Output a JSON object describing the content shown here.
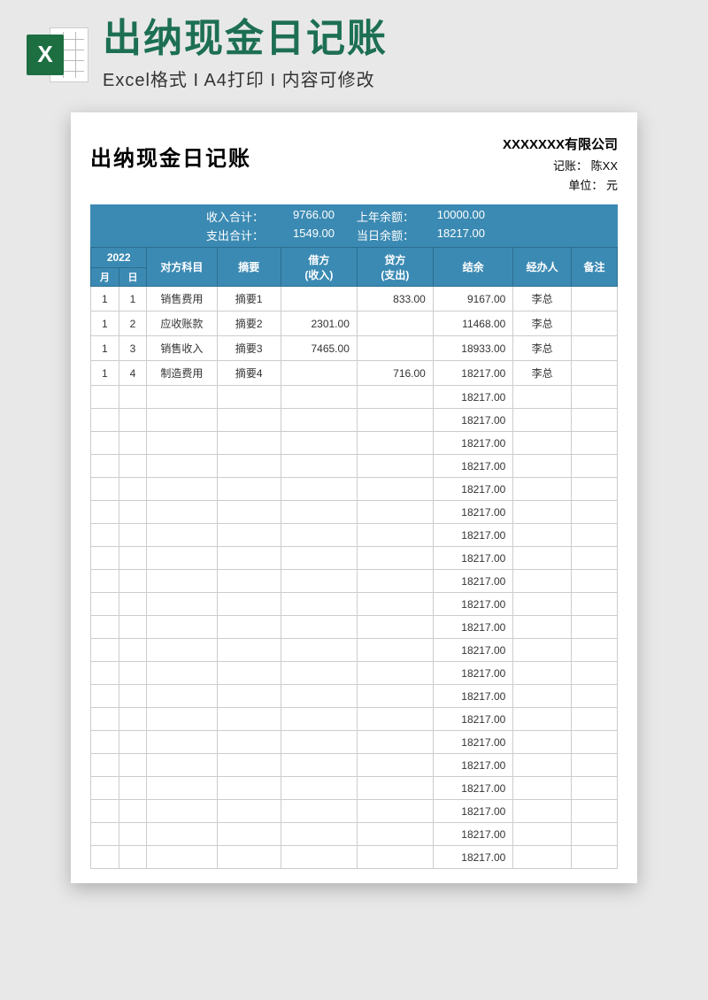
{
  "banner": {
    "excel_letter": "X",
    "title": "出纳现金日记账",
    "subtitle": "Excel格式 I A4打印 I 内容可修改"
  },
  "doc": {
    "title": "出纳现金日记账",
    "company": "XXXXXXX有限公司",
    "recorder_label": "记账：",
    "recorder": "陈XX",
    "unit_label": "单位：",
    "unit": "元"
  },
  "summary": {
    "income_label": "收入合计：",
    "income_value": "9766.00",
    "expense_label": "支出合计：",
    "expense_value": "1549.00",
    "prev_balance_label": "上年余额：",
    "prev_balance_value": "10000.00",
    "today_balance_label": "当日余额：",
    "today_balance_value": "18217.00"
  },
  "headers": {
    "year": "2022",
    "month": "月",
    "day": "日",
    "subject": "对方科目",
    "summary": "摘要",
    "debit": "借方",
    "debit_sub": "(收入)",
    "credit": "贷方",
    "credit_sub": "(支出)",
    "balance": "结余",
    "operator": "经办人",
    "remark": "备注"
  },
  "rows": [
    {
      "m": "1",
      "d": "1",
      "subject": "销售费用",
      "summary": "摘要1",
      "debit": "",
      "credit": "833.00",
      "balance": "9167.00",
      "op": "李总",
      "rm": ""
    },
    {
      "m": "1",
      "d": "2",
      "subject": "应收账款",
      "summary": "摘要2",
      "debit": "2301.00",
      "credit": "",
      "balance": "11468.00",
      "op": "李总",
      "rm": ""
    },
    {
      "m": "1",
      "d": "3",
      "subject": "销售收入",
      "summary": "摘要3",
      "debit": "7465.00",
      "credit": "",
      "balance": "18933.00",
      "op": "李总",
      "rm": ""
    },
    {
      "m": "1",
      "d": "4",
      "subject": "制造费用",
      "summary": "摘要4",
      "debit": "",
      "credit": "716.00",
      "balance": "18217.00",
      "op": "李总",
      "rm": ""
    },
    {
      "m": "",
      "d": "",
      "subject": "",
      "summary": "",
      "debit": "",
      "credit": "",
      "balance": "18217.00",
      "op": "",
      "rm": ""
    },
    {
      "m": "",
      "d": "",
      "subject": "",
      "summary": "",
      "debit": "",
      "credit": "",
      "balance": "18217.00",
      "op": "",
      "rm": ""
    },
    {
      "m": "",
      "d": "",
      "subject": "",
      "summary": "",
      "debit": "",
      "credit": "",
      "balance": "18217.00",
      "op": "",
      "rm": ""
    },
    {
      "m": "",
      "d": "",
      "subject": "",
      "summary": "",
      "debit": "",
      "credit": "",
      "balance": "18217.00",
      "op": "",
      "rm": ""
    },
    {
      "m": "",
      "d": "",
      "subject": "",
      "summary": "",
      "debit": "",
      "credit": "",
      "balance": "18217.00",
      "op": "",
      "rm": ""
    },
    {
      "m": "",
      "d": "",
      "subject": "",
      "summary": "",
      "debit": "",
      "credit": "",
      "balance": "18217.00",
      "op": "",
      "rm": ""
    },
    {
      "m": "",
      "d": "",
      "subject": "",
      "summary": "",
      "debit": "",
      "credit": "",
      "balance": "18217.00",
      "op": "",
      "rm": ""
    },
    {
      "m": "",
      "d": "",
      "subject": "",
      "summary": "",
      "debit": "",
      "credit": "",
      "balance": "18217.00",
      "op": "",
      "rm": ""
    },
    {
      "m": "",
      "d": "",
      "subject": "",
      "summary": "",
      "debit": "",
      "credit": "",
      "balance": "18217.00",
      "op": "",
      "rm": ""
    },
    {
      "m": "",
      "d": "",
      "subject": "",
      "summary": "",
      "debit": "",
      "credit": "",
      "balance": "18217.00",
      "op": "",
      "rm": ""
    },
    {
      "m": "",
      "d": "",
      "subject": "",
      "summary": "",
      "debit": "",
      "credit": "",
      "balance": "18217.00",
      "op": "",
      "rm": ""
    },
    {
      "m": "",
      "d": "",
      "subject": "",
      "summary": "",
      "debit": "",
      "credit": "",
      "balance": "18217.00",
      "op": "",
      "rm": ""
    },
    {
      "m": "",
      "d": "",
      "subject": "",
      "summary": "",
      "debit": "",
      "credit": "",
      "balance": "18217.00",
      "op": "",
      "rm": ""
    },
    {
      "m": "",
      "d": "",
      "subject": "",
      "summary": "",
      "debit": "",
      "credit": "",
      "balance": "18217.00",
      "op": "",
      "rm": ""
    },
    {
      "m": "",
      "d": "",
      "subject": "",
      "summary": "",
      "debit": "",
      "credit": "",
      "balance": "18217.00",
      "op": "",
      "rm": ""
    },
    {
      "m": "",
      "d": "",
      "subject": "",
      "summary": "",
      "debit": "",
      "credit": "",
      "balance": "18217.00",
      "op": "",
      "rm": ""
    },
    {
      "m": "",
      "d": "",
      "subject": "",
      "summary": "",
      "debit": "",
      "credit": "",
      "balance": "18217.00",
      "op": "",
      "rm": ""
    },
    {
      "m": "",
      "d": "",
      "subject": "",
      "summary": "",
      "debit": "",
      "credit": "",
      "balance": "18217.00",
      "op": "",
      "rm": ""
    },
    {
      "m": "",
      "d": "",
      "subject": "",
      "summary": "",
      "debit": "",
      "credit": "",
      "balance": "18217.00",
      "op": "",
      "rm": ""
    },
    {
      "m": "",
      "d": "",
      "subject": "",
      "summary": "",
      "debit": "",
      "credit": "",
      "balance": "18217.00",
      "op": "",
      "rm": ""
    },
    {
      "m": "",
      "d": "",
      "subject": "",
      "summary": "",
      "debit": "",
      "credit": "",
      "balance": "18217.00",
      "op": "",
      "rm": ""
    }
  ]
}
